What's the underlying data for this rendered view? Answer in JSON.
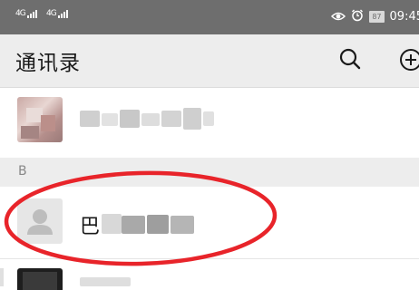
{
  "status_bar": {
    "signal_1": "4G",
    "signal_2": "4G",
    "battery": "87",
    "time": "09:45"
  },
  "header": {
    "title": "通讯录"
  },
  "sections": {
    "letter": "B"
  },
  "contacts": {
    "highlighted_name_prefix": "巴"
  },
  "colors": {
    "status_bar_bg": "#6e6e6e",
    "header_bg": "#ededed",
    "highlight_oval": "#e8242a"
  }
}
